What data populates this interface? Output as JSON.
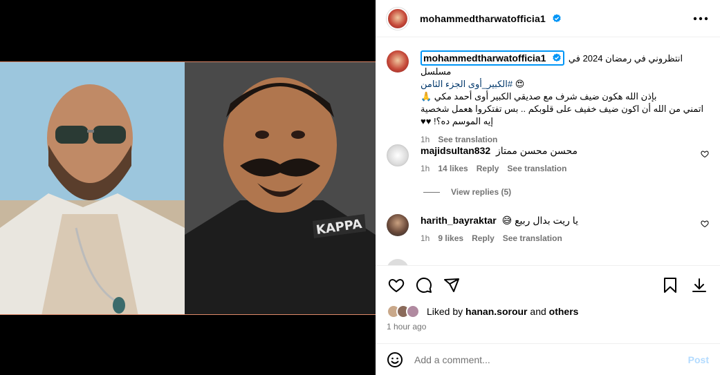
{
  "post": {
    "username": "mohammedtharwatofficia1",
    "more_icon": "more-horizontal-icon",
    "verified_icon": "verified-badge-icon"
  },
  "caption": {
    "username": "mohammedtharwatofficia1",
    "line1": "انتظروني في رمضان 2024 في مسلسل",
    "hashtag": "#الكبير_أوى الجزء الثامن",
    "emoji1": "😍",
    "line2": "بإذن الله هكون ضيف شرف مع صديقي الكبير أوى أحمد مكي 🙏",
    "line3": "اتمني من الله أن اكون ضيف خفيف على قلوبكم .. بس تفتكروا هعمل شخصية إيه الموسم ده؟! ♥♥",
    "time": "1h",
    "see_translation": "See translation"
  },
  "comments": [
    {
      "username": "majidsultan832",
      "text": "محسن محسن ممتاز",
      "time": "1h",
      "likes": "14 likes",
      "reply": "Reply",
      "see_translation": "See translation",
      "view_replies": "View replies (5)"
    },
    {
      "username": "harith_bayraktar",
      "text": "يا ريت بدال ربيع 😅",
      "time": "1h",
      "likes": "9 likes",
      "reply": "Reply",
      "see_translation": "See translation"
    }
  ],
  "likes": {
    "prefix": "Liked by",
    "user": "hanan.sorour",
    "and": "and",
    "others": "others"
  },
  "time_ago": "1 hour ago",
  "add_comment": {
    "placeholder": "Add a comment...",
    "post_label": "Post"
  },
  "colors": {
    "link_blue": "#0095f6",
    "post_disabled": "#b3dbff",
    "secondary_text": "#737373"
  }
}
